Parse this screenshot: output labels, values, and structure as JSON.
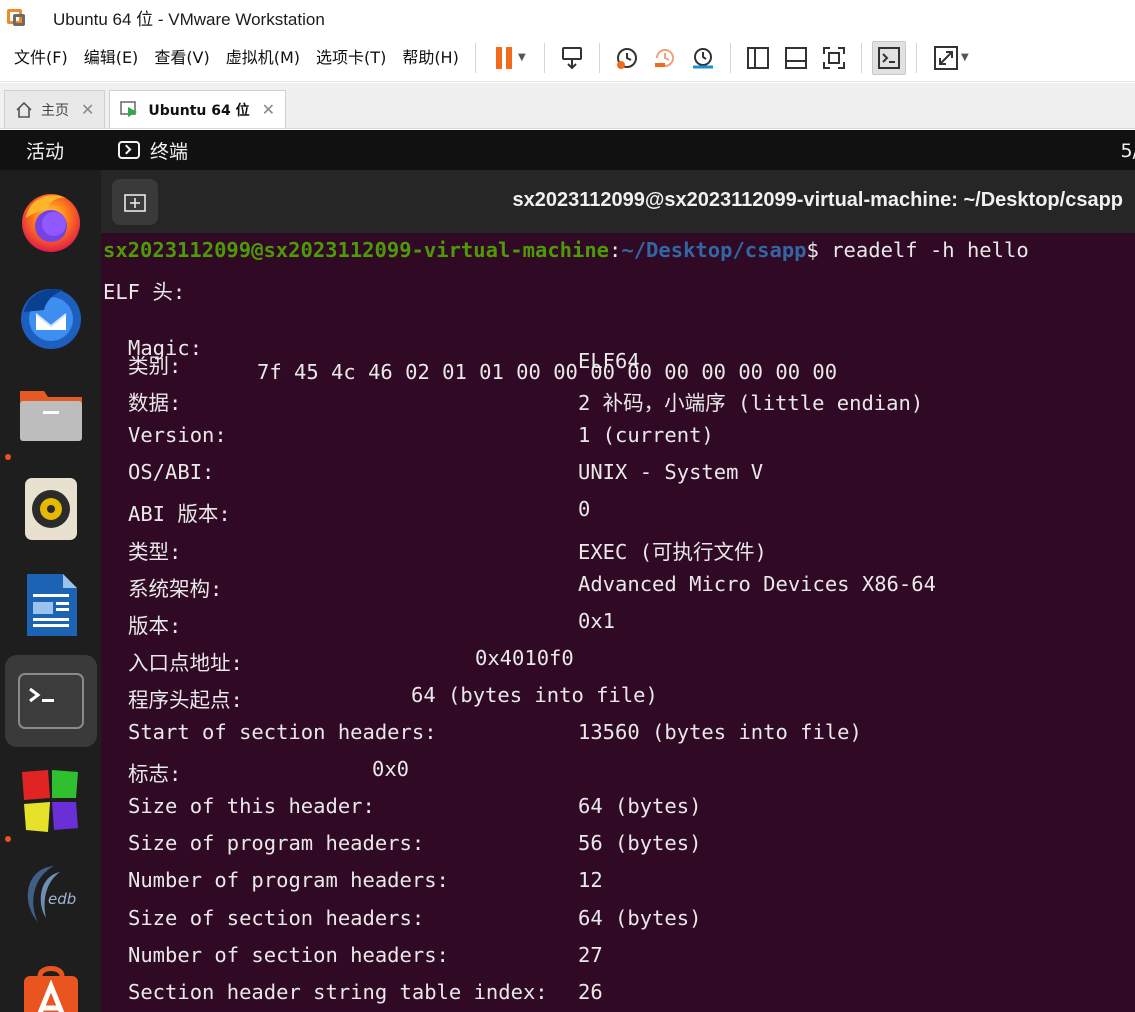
{
  "window": {
    "title": "Ubuntu 64 位 - VMware Workstation"
  },
  "menu": [
    "文件(F)",
    "编辑(E)",
    "查看(V)",
    "虚拟机(M)",
    "选项卡(T)",
    "帮助(H)"
  ],
  "toolbar": {
    "icons": [
      "pause-icon",
      "send-keys-icon",
      "snapshot-icon",
      "revert-snapshot-icon",
      "snapshot-manager-icon",
      "sidebar-icon",
      "thumbnail-bar-icon",
      "fullscreen-icon",
      "console-view-icon",
      "stretch-icon"
    ],
    "accent": "#f26b1d"
  },
  "tabs": [
    {
      "label": "主页",
      "icon": "home-icon",
      "active": false
    },
    {
      "label": "Ubuntu 64 位",
      "icon": "vm-running-icon",
      "active": true
    }
  ],
  "ubuntu": {
    "activities": "活动",
    "app_menu": "终端",
    "clock_fragment": "5/",
    "dock": [
      "firefox-icon",
      "thunderbird-icon",
      "files-icon",
      "rhythmbox-icon",
      "libreoffice-writer-icon",
      "terminal-icon",
      "app-grid-colored-icon",
      "edb-debugger-icon",
      "app-center-icon"
    ]
  },
  "terminal": {
    "title": "sx2023112099@sx2023112099-virtual-machine: ~/Desktop/csapp",
    "prompt_user": "sx2023112099@sx2023112099-virtual-machine",
    "prompt_sep": ":",
    "prompt_path": "~/Desktop/csapp",
    "prompt_end": "$ ",
    "command": "readelf -h hello",
    "header": "ELF 头:",
    "magic_label": "Magic:",
    "magic_value": "7f 45 4c 46 02 01 01 00 00 00 00 00 00 00 00 00",
    "rows": [
      {
        "label": "类别:",
        "value": "ELF64"
      },
      {
        "label": "数据:",
        "value": "2 补码，小端序 (little endian)"
      },
      {
        "label": "Version:",
        "value": "1 (current)"
      },
      {
        "label": "OS/ABI:",
        "value": "UNIX - System V"
      },
      {
        "label": "ABI 版本:",
        "value": "0"
      },
      {
        "label": "类型:",
        "value": "EXEC (可执行文件)"
      },
      {
        "label": "系统架构:",
        "value": "Advanced Micro Devices X86-64"
      },
      {
        "label": "版本:",
        "value": "0x1"
      },
      {
        "label": "入口点地址:",
        "value": "0x4010f0"
      },
      {
        "label": "程序头起点:",
        "value": "64 (bytes into file)"
      },
      {
        "label": "Start of section headers:",
        "value": "13560 (bytes into file)"
      },
      {
        "label": "标志:",
        "value": "0x0"
      },
      {
        "label": "Size of this header:",
        "value": "64 (bytes)"
      },
      {
        "label": "Size of program headers:",
        "value": "56 (bytes)"
      },
      {
        "label": "Number of program headers:",
        "value": "12"
      },
      {
        "label": "Size of section headers:",
        "value": "64 (bytes)"
      },
      {
        "label": "Number of section headers:",
        "value": "27"
      },
      {
        "label": "Section header string table index:",
        "value": "26"
      }
    ]
  }
}
